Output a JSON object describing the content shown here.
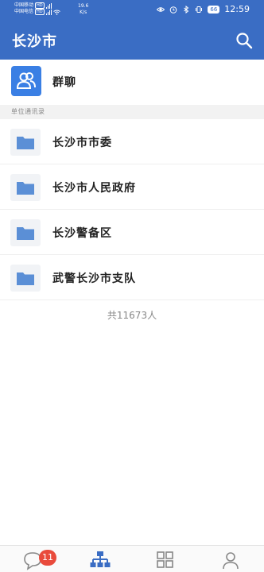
{
  "status_bar": {
    "carrier1": "中国移动",
    "carrier1_tag": "HD",
    "carrier2": "中国电信",
    "carrier2_tag": "HD",
    "speed_value": "19.6",
    "speed_unit": "K/s",
    "battery": "66",
    "time": "12:59"
  },
  "header": {
    "title": "长沙市"
  },
  "group_chat": {
    "label": "群聊"
  },
  "section": {
    "label": "单位通讯录"
  },
  "org_list": [
    {
      "label": "长沙市市委"
    },
    {
      "label": "长沙市人民政府"
    },
    {
      "label": "长沙警备区"
    },
    {
      "label": "武警长沙市支队"
    }
  ],
  "summary": {
    "total": "共11673人"
  },
  "tab_bar": {
    "messages_badge": "11"
  },
  "colors": {
    "primary": "#3a6dc4",
    "avatar": "#3a7fe4",
    "folder": "#5b8fd6",
    "badge": "#e94b3c"
  }
}
